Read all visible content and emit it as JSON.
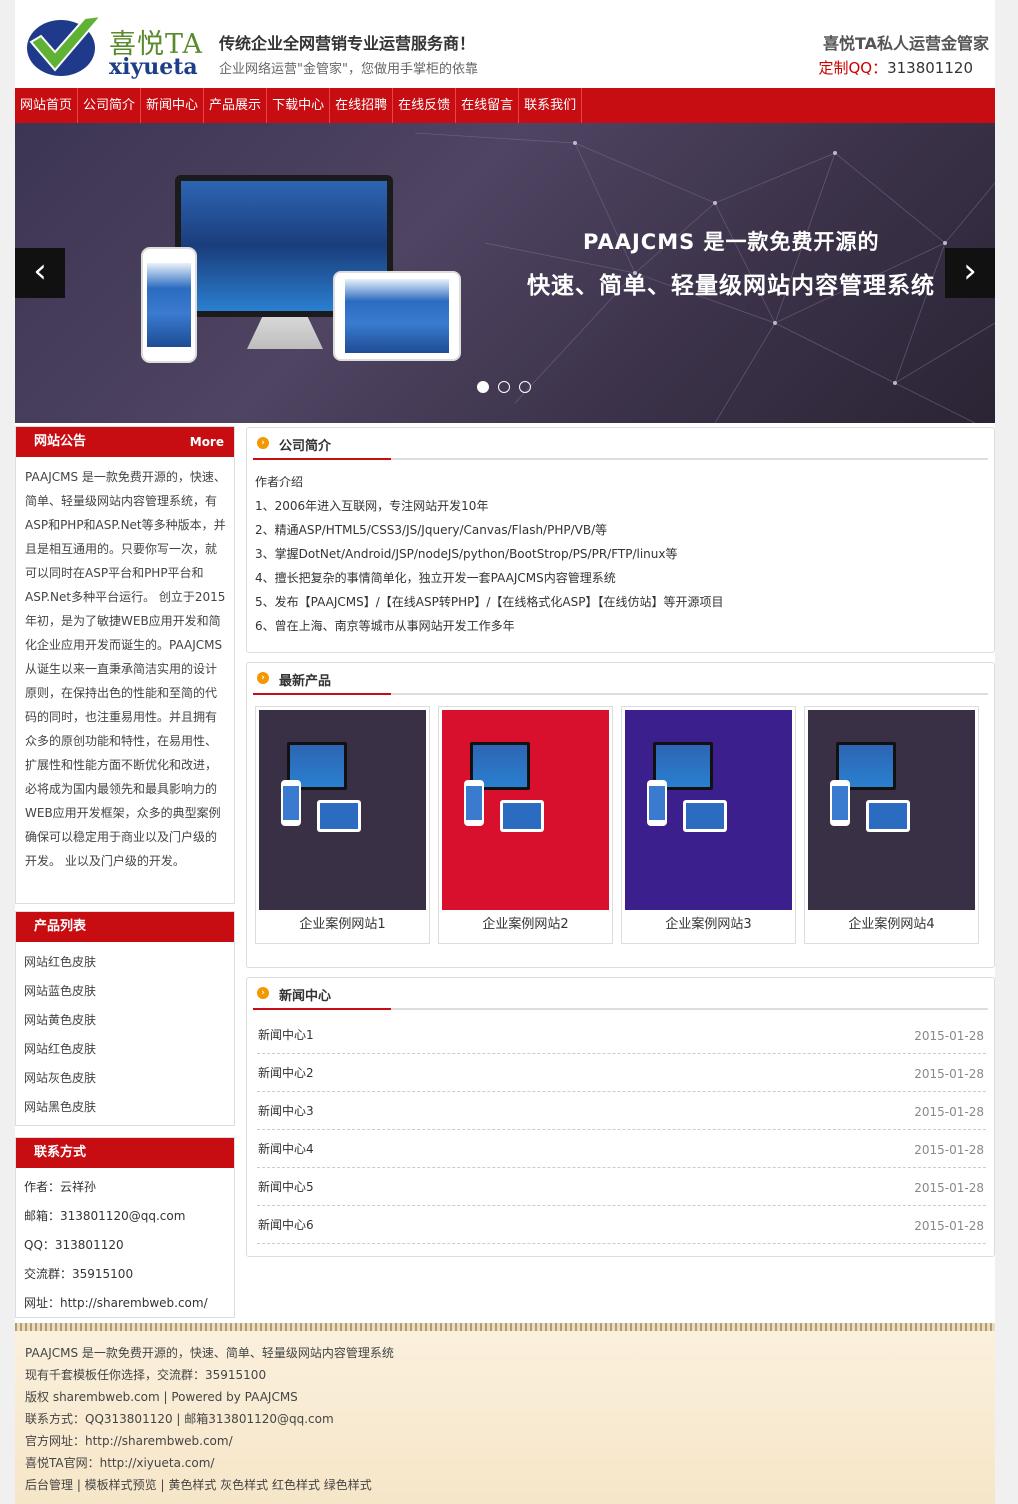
{
  "header": {
    "logo_cn": "喜悦TA",
    "logo_en": "xiyueta",
    "slogan_main": "传统企业全网营销专业运营服务商！",
    "slogan_sub": "企业网络运营\"金管家\"，您做用手掌柜的依靠",
    "right_title": "喜悦TA私人运营金管家",
    "qq_label": "定制QQ：",
    "qq_number": "313801120"
  },
  "nav": [
    "网站首页",
    "公司简介",
    "新闻中心",
    "产品展示",
    "下载中心",
    "在线招聘",
    "在线反馈",
    "在线留言",
    "联系我们"
  ],
  "banner": {
    "line1": "PAAJCMS 是一款免费开源的",
    "line2": "快速、简单、轻量级网站内容管理系统",
    "prev": "‹",
    "next": "›",
    "slides": 3,
    "active": 0
  },
  "sidebar": {
    "notice_title": "网站公告",
    "notice_more": "More",
    "notice_text": "PAAJCMS 是一款免费开源的，快速、简单、轻量级网站内容管理系统，有ASP和PHP和ASP.Net等多种版本，并且是相互通用的。只要你写一次，就可以同时在ASP平台和PHP平台和ASP.Net多种平台运行。 创立于2015年初，是为了敏捷WEB应用开发和简化企业应用开发而诞生的。PAAJCMS从诞生以来一直秉承简洁实用的设计原则，在保持出色的性能和至简的代码的同时，也注重易用性。并且拥有众多的原创功能和特性，在易用性、扩展性和性能方面不断优化和改进，必将成为国内最领先和最具影响力的WEB应用开发框架，众多的典型案例确保可以稳定用于商业以及门户级的开发。 业以及门户级的开发。",
    "products_title": "产品列表",
    "products": [
      "网站红色皮肤",
      "网站蓝色皮肤",
      "网站黄色皮肤",
      "网站红色皮肤",
      "网站灰色皮肤",
      "网站黑色皮肤"
    ],
    "contact_title": "联系方式",
    "contact": [
      "作者：云祥孙",
      "邮箱：313801120@qq.com",
      "QQ：313801120",
      "交流群：35915100",
      "网址：http://sharembweb.com/"
    ]
  },
  "about": {
    "title": "公司简介",
    "lines": [
      "作者介绍",
      "1、2006年进入互联网，专注网站开发10年",
      "2、精通ASP/HTML5/CSS3/JS/Jquery/Canvas/Flash/PHP/VB/等",
      "3、掌握DotNet/Android/JSP/nodeJS/python/BootStrop/PS/PR/FTP/linux等",
      "4、擅长把复杂的事情简单化，独立开发一套PAAJCMS内容管理系统",
      "5、发布【PAAJCMS】/【在线ASP转PHP】/【在线格式化ASP】【在线仿站】等开源项目",
      "6、曾在上海、南京等城市从事网站开发工作多年"
    ]
  },
  "products_panel": {
    "title": "最新产品",
    "items": [
      {
        "name": "企业案例网站1",
        "bg": "#3a3046"
      },
      {
        "name": "企业案例网站2",
        "bg": "#d8102d"
      },
      {
        "name": "企业案例网站3",
        "bg": "#3b1f8c"
      },
      {
        "name": "企业案例网站4",
        "bg": "#3a3046"
      }
    ]
  },
  "news": {
    "title": "新闻中心",
    "items": [
      {
        "title": "新闻中心1",
        "date": "2015-01-28"
      },
      {
        "title": "新闻中心2",
        "date": "2015-01-28"
      },
      {
        "title": "新闻中心3",
        "date": "2015-01-28"
      },
      {
        "title": "新闻中心4",
        "date": "2015-01-28"
      },
      {
        "title": "新闻中心5",
        "date": "2015-01-28"
      },
      {
        "title": "新闻中心6",
        "date": "2015-01-28"
      }
    ]
  },
  "footer": [
    "PAAJCMS 是一款免费开源的，快速、简单、轻量级网站内容管理系统",
    "现有千套模板任你选择，交流群：35915100",
    "版权 sharembweb.com | Powered by PAAJCMS",
    "联系方式：QQ313801120 | 邮箱313801120@qq.com",
    "官方网址：http://sharembweb.com/",
    "喜悦TA官网：http://xiyueta.com/",
    "后台管理 | 模板样式预览  | 黄色样式 灰色样式 红色样式 绿色样式"
  ],
  "colors": {
    "brand_red": "#c70d12",
    "accent_orange": "#f39800"
  }
}
